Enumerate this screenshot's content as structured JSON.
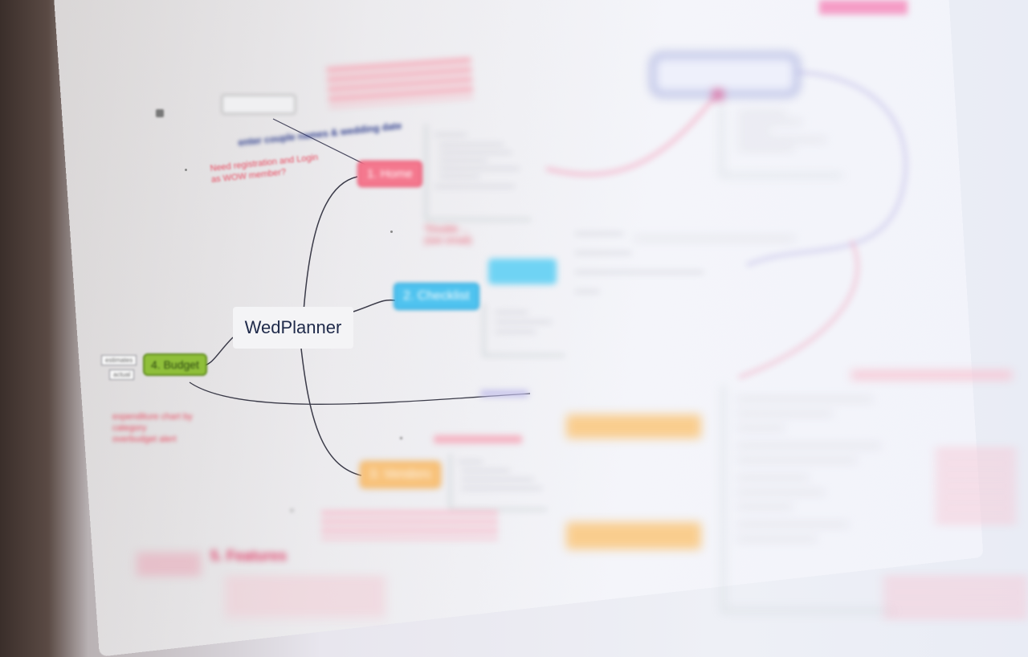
{
  "mindmap": {
    "central": "WedPlanner",
    "branches": {
      "home": "1. Home",
      "checklist": "2. Checklist",
      "vendors": "3. Vendors",
      "budget": "4. Budget"
    }
  },
  "annotations": {
    "couple_instruction": "enter couple names & wedding date",
    "registration_note_1": "Need registration and Login",
    "registration_note_2": "as WOW member?",
    "budget_note_1": "expenditure chart by",
    "budget_note_2": "category",
    "budget_note_3": "overbudget alert",
    "double_note_1": "*Double ...",
    "double_note_2": "(see email)",
    "budget_tag_estimates": "estimates",
    "budget_tag_actual": "actual",
    "legend_label": "5. Features"
  },
  "colors": {
    "home": "#f4788e",
    "checklist": "#4fc3ef",
    "budget": "#8fbf3a",
    "vendors": "#f8c27a",
    "link": "#2c2c3a",
    "pink_link": "#f08aa8",
    "profile_border": "#9ba3d8"
  }
}
